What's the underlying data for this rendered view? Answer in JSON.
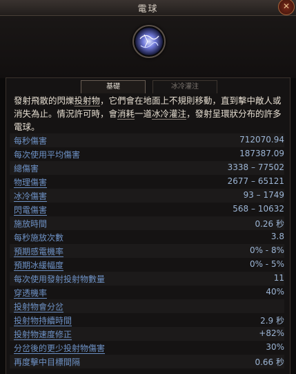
{
  "window": {
    "title": "電球",
    "close_glyph": "✕"
  },
  "tabs": [
    {
      "label": "基礎",
      "active": true
    },
    {
      "label": "冰冷灌注",
      "active": false
    }
  ],
  "description": {
    "p1": "發射飛散的閃爍",
    "kw1": "投射物",
    "p2": "，它們會在地面上不規則移動，直到擊中敵人或消失為止。情況許可時，會",
    "kw2": "消耗",
    "p3": "一道",
    "kw3": "冰冷灌注",
    "p4": "，發射呈環狀分布的許多電球。"
  },
  "stats": [
    {
      "label": "每秒傷害",
      "value": "712070.94"
    },
    {
      "label": "每次使用平均傷害",
      "value": "187387.09"
    },
    {
      "label": "總傷害",
      "value": "3338 – 77502"
    },
    {
      "label": "物理傷害",
      "value": "2677 – 65121"
    },
    {
      "label": "冰冷傷害",
      "value": "93 – 1749"
    },
    {
      "label": "閃電傷害",
      "value": "568 – 10632"
    },
    {
      "label": "施放時間",
      "value": "0.26 秒"
    },
    {
      "label": "每秒施放次數",
      "value": "3.8"
    },
    {
      "label": "預期感電機率",
      "value": "0% - 8%"
    },
    {
      "label": "預期冰緩幅度",
      "value": "0% - 5%"
    },
    {
      "label": "每次使用發射投射物數量",
      "value": "11"
    },
    {
      "label": "穿透機率",
      "value": "40%"
    },
    {
      "label": "投射物會分岔",
      "value": ""
    },
    {
      "label": "投射物持續時間",
      "value": "2.9 秒"
    },
    {
      "label": "投射物速度修正",
      "value": "+82%"
    },
    {
      "label": "分岔後的更少投射物傷害",
      "value": "30%"
    },
    {
      "label": "再度擊中目標間隔",
      "value": "0.66 秒"
    }
  ],
  "colors": {
    "label": "#6e92c6",
    "value": "#9db6d6",
    "text": "#e5ddd0",
    "accent_border": "#a8643a"
  },
  "icons": {
    "skill": "lightning-orb-icon",
    "close": "close-icon"
  }
}
